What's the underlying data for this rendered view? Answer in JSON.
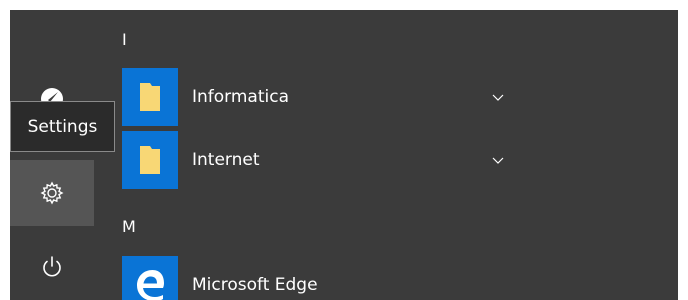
{
  "tooltip": {
    "text": "Settings"
  },
  "rail": {
    "items": [
      {
        "icon": "user-icon"
      },
      {
        "icon": "gear-icon"
      },
      {
        "icon": "power-icon"
      }
    ]
  },
  "app_list": {
    "groups": [
      {
        "header": "I",
        "apps": [
          {
            "label": "Informatica",
            "icon": "folder-icon",
            "expandable": true
          },
          {
            "label": "Internet",
            "icon": "folder-icon",
            "expandable": true
          }
        ]
      },
      {
        "header": "M",
        "apps": [
          {
            "label": "Microsoft Edge",
            "icon": "edge-icon",
            "expandable": false
          }
        ]
      }
    ]
  },
  "colors": {
    "menu_background": "#3b3b3b",
    "tile_blue": "#0a74d6",
    "folder_yellow": "#f8d775",
    "hover_gray": "#555555",
    "tooltip_background": "#2b2b2b"
  }
}
